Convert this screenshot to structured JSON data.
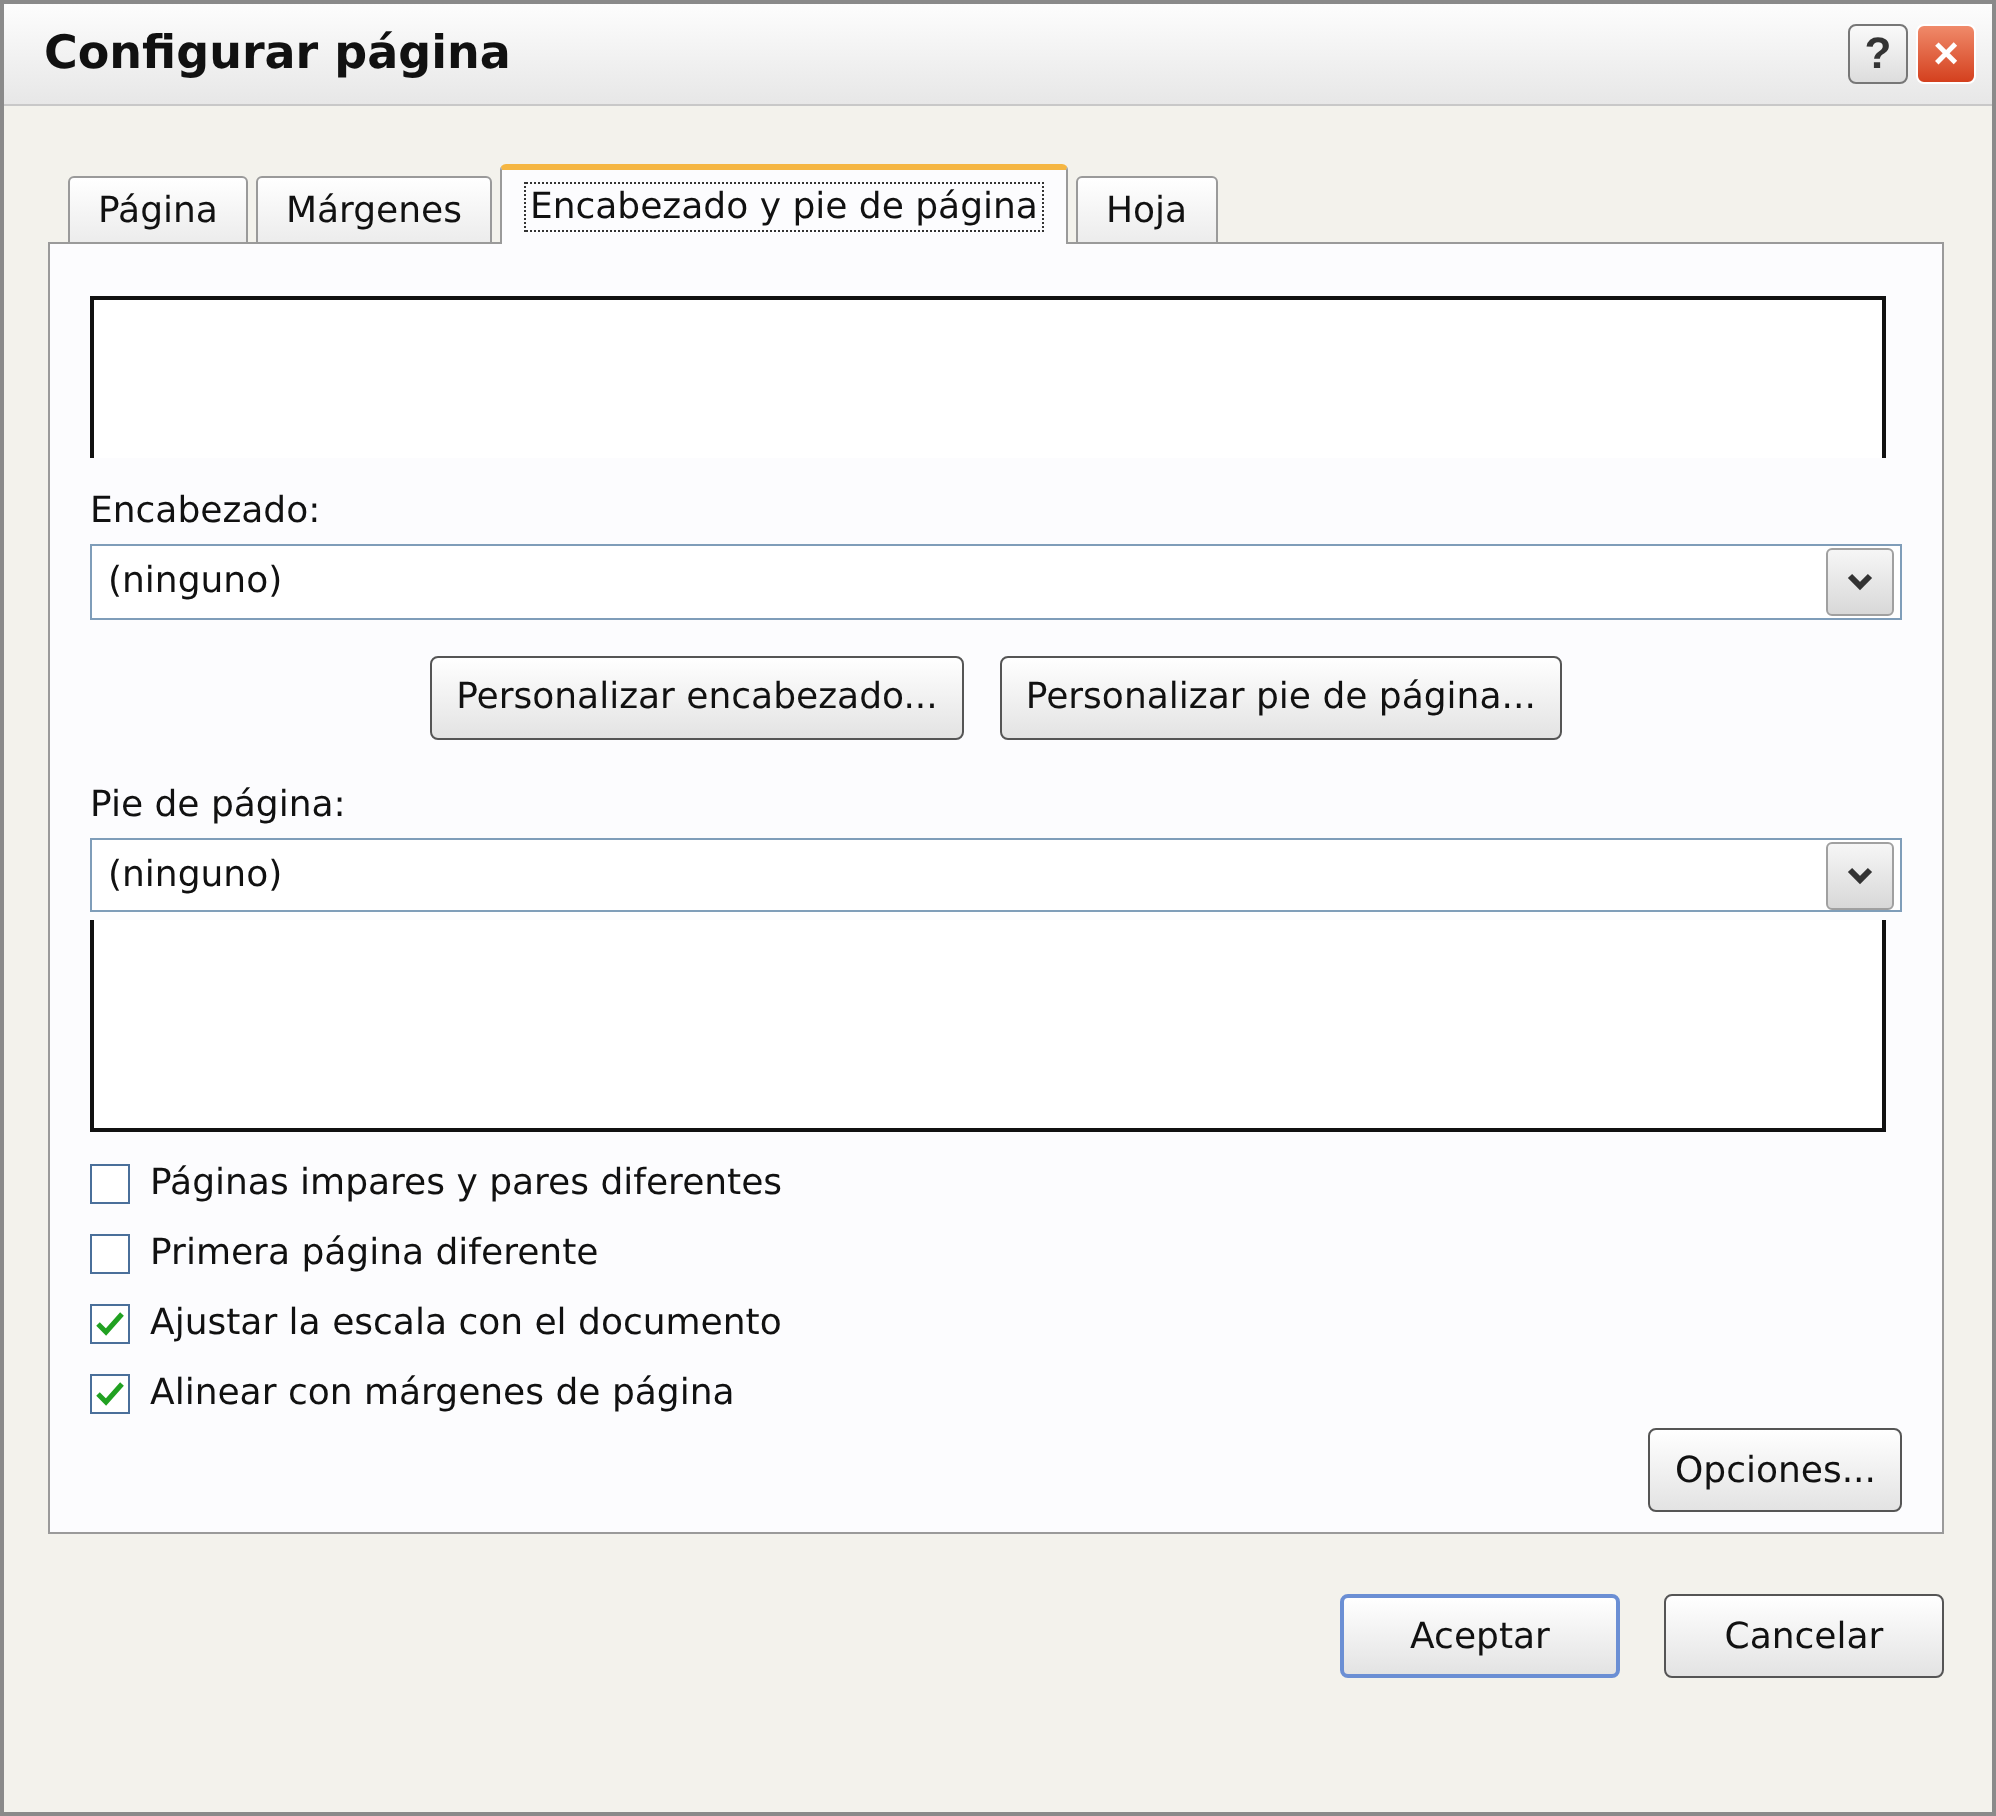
{
  "window": {
    "title": "Configurar página",
    "help": "?",
    "close": "×"
  },
  "tabs": [
    {
      "label": "Página",
      "selected": false
    },
    {
      "label": "Márgenes",
      "selected": false
    },
    {
      "label": "Encabezado y pie de página",
      "selected": true
    },
    {
      "label": "Hoja",
      "selected": false
    }
  ],
  "header": {
    "label": "Encabezado:",
    "value": "(ninguno)"
  },
  "custom_buttons": [
    "Personalizar encabezado...",
    "Personalizar pie de página..."
  ],
  "footer": {
    "label": "Pie de página:",
    "value": "(ninguno)"
  },
  "options": [
    {
      "label": "Páginas impares y pares diferentes",
      "checked": false
    },
    {
      "label": "Primera página diferente",
      "checked": false
    },
    {
      "label": "Ajustar la escala con el documento",
      "checked": true
    },
    {
      "label": "Alinear con márgenes de página",
      "checked": true
    }
  ],
  "options_button": "Opciones...",
  "buttons": [
    {
      "label": "Aceptar",
      "default": true
    },
    {
      "label": "Cancelar",
      "default": false
    }
  ]
}
